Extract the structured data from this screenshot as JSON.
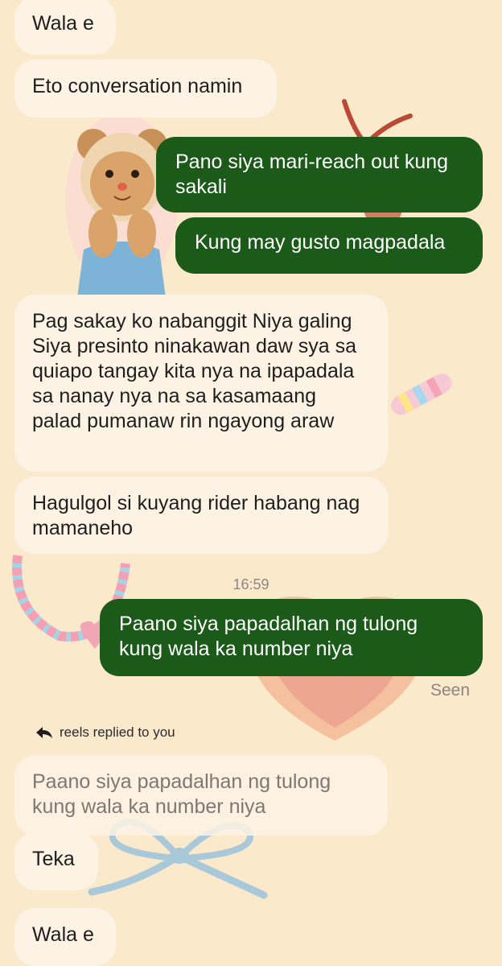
{
  "messages": [
    {
      "text": "Wala e"
    },
    {
      "text": "Eto conversation namin"
    },
    {
      "text": "Pano siya mari-reach out kung sakali"
    },
    {
      "text": "Kung may gusto magpadala"
    },
    {
      "text": "Pag sakay ko nabanggit Niya galing Siya presinto ninakawan daw sya sa quiapo tangay kita nya na ipapadala sa nanay nya na sa kasamaang palad pumanaw rin ngayong araw"
    },
    {
      "text": "Hagulgol si kuyang rider habang nag mamaneho"
    },
    {
      "text": "Paano siya papadalhan ng tulong kung wala ka number niya"
    },
    {
      "text": "Teka"
    },
    {
      "text": "Wala e"
    }
  ],
  "timestamp": "16:59",
  "seen": "Seen",
  "reply": {
    "label": "reels replied to you",
    "quoted_text": "Paano siya papadalhan ng tulong kung wala ka number niya"
  },
  "colors": {
    "background": "#fbe9cc",
    "incoming": "#fdf3e4",
    "outgoing": "#1b5a18"
  }
}
